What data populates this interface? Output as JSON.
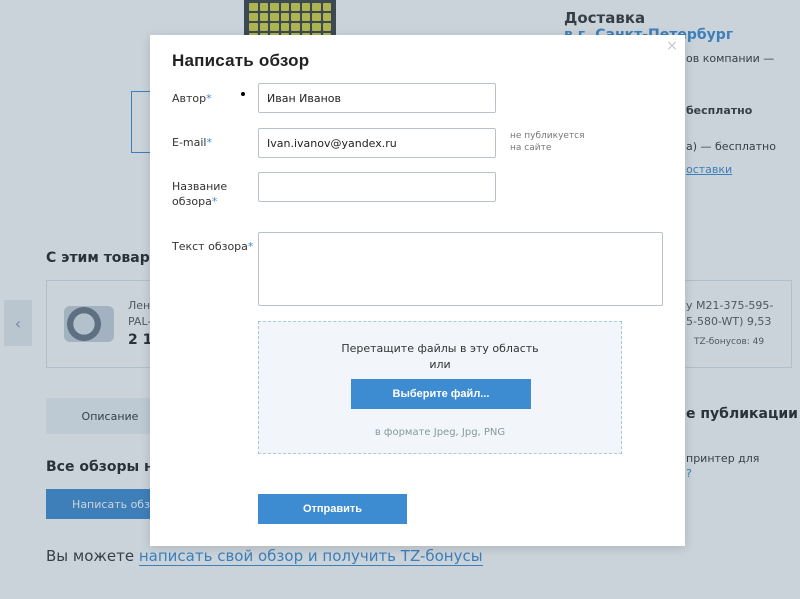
{
  "background": {
    "delivery_title": "Доставка",
    "delivery_city": "в г. Санкт-Петербург",
    "delivery_line1": "ов компании —",
    "delivery_line2": "бесплатно",
    "delivery_line3": "а) — бесплатно",
    "delivery_link": "оставки",
    "with_product_title": "С этим товаро",
    "product1_name_line1": "Лент",
    "product1_name_line2": "PAL-",
    "product1_price": "2 16",
    "product2_name_line1": "y M21-375-595-",
    "product2_name_line2": "5-580-WT) 9,53",
    "product2_bonus": "TZ-бонусов: 49",
    "tab_description": "Описание",
    "all_reviews_title": "Все обзоры на",
    "write_review_button": "Написать обз",
    "publications_title": "е публикации",
    "publications_text_line1": "принтер для",
    "publications_text_line2": "?",
    "bottom_text": "Вы можете ",
    "bottom_link": "написать свой обзор и получить TZ-бонусы"
  },
  "modal": {
    "title": "Написать обзор",
    "close_label": "×",
    "author_label": "Автор",
    "author_value": "Иван Иванов",
    "email_label": "E-mail",
    "email_value": "Ivan.ivanov@yandex.ru",
    "email_note_line1": "не публикуется",
    "email_note_line2": "на сайте",
    "review_title_label_line1": "Название",
    "review_title_label_line2": "обзора",
    "review_title_value": "",
    "review_text_label": "Текст обзора",
    "review_text_value": "",
    "required_mark": "*",
    "dropzone_text_line1": "Перетащите файлы в эту область",
    "dropzone_text_line2": "или",
    "choose_file_button": "Выберите файл...",
    "file_formats": "в формате Jpeg, Jpg, PNG",
    "submit_button": "Отправить"
  }
}
